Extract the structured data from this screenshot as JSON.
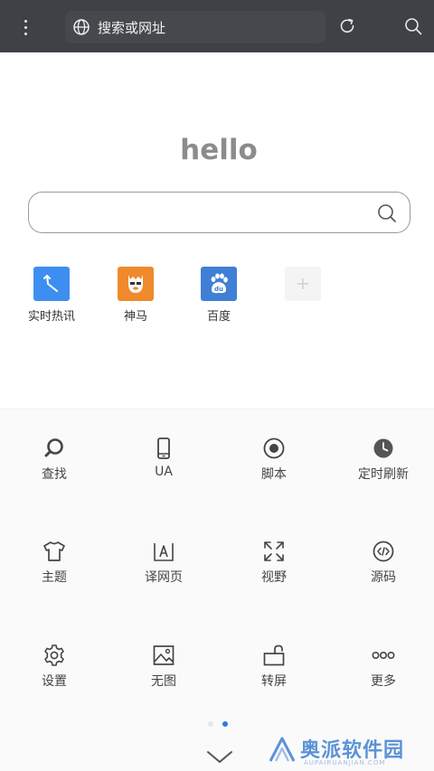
{
  "toolbar": {
    "url_placeholder": "搜索或网址",
    "icons": [
      "menu-dots-icon",
      "globe-icon",
      "refresh-icon",
      "search-icon"
    ]
  },
  "home": {
    "logo_text": "hello",
    "search_placeholder": "",
    "shortcuts": [
      {
        "label": "实时热讯",
        "color": "#3d8ef0",
        "icon": "arrow-icon"
      },
      {
        "label": "神马",
        "color": "#f08a2c",
        "icon": "alpaca-icon"
      },
      {
        "label": "百度",
        "color": "#3f7fd6",
        "icon": "baidu-paw-icon"
      },
      {
        "label": "",
        "color": "#f4f4f4",
        "icon": "add-icon"
      }
    ]
  },
  "menu": {
    "items": [
      {
        "label": "查找",
        "icon": "find-icon"
      },
      {
        "label": "UA",
        "icon": "phone-icon"
      },
      {
        "label": "脚本",
        "icon": "script-icon"
      },
      {
        "label": "定时刷新",
        "icon": "clock-icon"
      },
      {
        "label": "主题",
        "icon": "tshirt-icon"
      },
      {
        "label": "译网页",
        "icon": "translate-icon"
      },
      {
        "label": "视野",
        "icon": "expand-icon"
      },
      {
        "label": "源码",
        "icon": "code-icon"
      },
      {
        "label": "设置",
        "icon": "gear-icon"
      },
      {
        "label": "无图",
        "icon": "image-icon"
      },
      {
        "label": "转屏",
        "icon": "rotate-lock-icon"
      },
      {
        "label": "更多",
        "icon": "more-icon"
      }
    ],
    "page_indicator": {
      "pages": 2,
      "current": 2
    }
  },
  "watermark": {
    "text": "奥派软件园",
    "sub": "AUPAIRUANJIAN.COM",
    "color": "#5b92d8"
  }
}
